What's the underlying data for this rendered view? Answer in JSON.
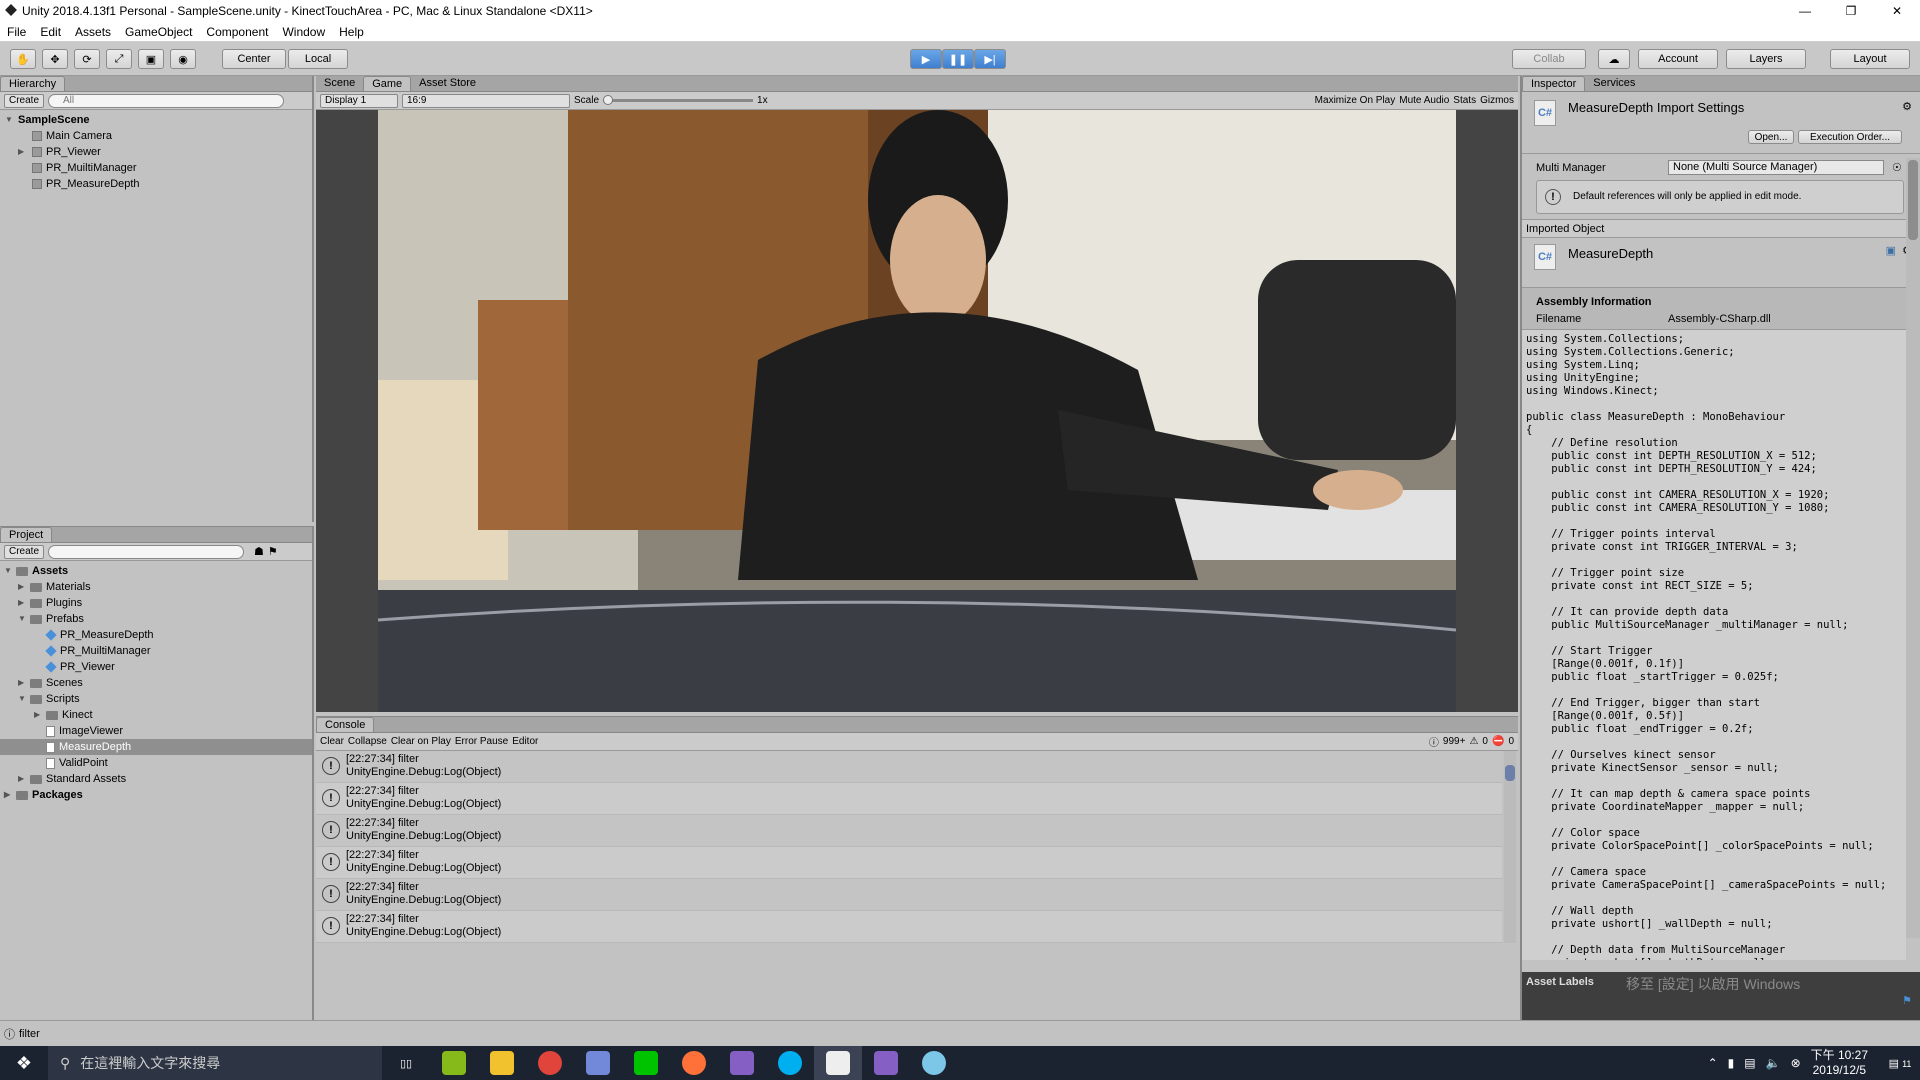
{
  "window": {
    "title": "Unity 2018.4.13f1 Personal - SampleScene.unity - KinectTouchArea - PC, Mac & Linux Standalone <DX11>"
  },
  "menu": [
    "File",
    "Edit",
    "Assets",
    "GameObject",
    "Component",
    "Window",
    "Help"
  ],
  "toolbar": {
    "center": "Center",
    "local": "Local",
    "collab": "Collab",
    "account": "Account",
    "layers": "Layers",
    "layout": "Layout"
  },
  "hierarchy": {
    "tab": "Hierarchy",
    "create": "Create",
    "search_placeholder": "All",
    "scene": "SampleScene",
    "items": [
      "Main Camera",
      "PR_Viewer",
      "PR_MuiltiManager",
      "PR_MeasureDepth"
    ]
  },
  "game": {
    "tabs": [
      "Scene",
      "Game",
      "Asset Store"
    ],
    "display": "Display 1",
    "aspect": "16:9",
    "scale_label": "Scale",
    "scale_value": "1x",
    "options": [
      "Maximize On Play",
      "Mute Audio",
      "Stats",
      "Gizmos"
    ]
  },
  "project": {
    "tab": "Project",
    "create": "Create",
    "assets": "Assets",
    "folders": [
      "Materials",
      "Plugins",
      "Prefabs"
    ],
    "prefabs": [
      "PR_MeasureDepth",
      "PR_MuiltiManager",
      "PR_Viewer"
    ],
    "folders2": [
      "Scenes",
      "Scripts"
    ],
    "scripts": [
      "Kinect",
      "ImageViewer",
      "MeasureDepth",
      "ValidPoint"
    ],
    "standard": "Standard Assets",
    "packages": "Packages"
  },
  "console": {
    "tab": "Console",
    "buttons": [
      "Clear",
      "Collapse",
      "Clear on Play",
      "Error Pause",
      "Editor"
    ],
    "count_logs": "999+",
    "count_warn": "0",
    "count_err": "0",
    "entries": [
      {
        "l1": "[22:27:34] filter",
        "l2": "UnityEngine.Debug:Log(Object)"
      },
      {
        "l1": "[22:27:34] filter",
        "l2": "UnityEngine.Debug:Log(Object)"
      },
      {
        "l1": "[22:27:34] filter",
        "l2": "UnityEngine.Debug:Log(Object)"
      },
      {
        "l1": "[22:27:34] filter",
        "l2": "UnityEngine.Debug:Log(Object)"
      },
      {
        "l1": "[22:27:34] filter",
        "l2": "UnityEngine.Debug:Log(Object)"
      },
      {
        "l1": "[22:27:34] filter",
        "l2": "UnityEngine.Debug:Log(Object)"
      }
    ]
  },
  "inspector": {
    "tabs": [
      "Inspector",
      "Services"
    ],
    "title": "MeasureDepth Import Settings",
    "open": "Open...",
    "exec_order": "Execution Order...",
    "multi_label": "Multi Manager",
    "multi_value": "None (Multi Source Manager)",
    "notice": "Default references will only be applied in edit mode.",
    "imported": "Imported Object",
    "script_name": "MeasureDepth",
    "assembly_title": "Assembly Information",
    "filename_label": "Filename",
    "filename_value": "Assembly-CSharp.dll",
    "code": "using System.Collections;\nusing System.Collections.Generic;\nusing System.Linq;\nusing UnityEngine;\nusing Windows.Kinect;\n\npublic class MeasureDepth : MonoBehaviour\n{\n    // Define resolution\n    public const int DEPTH_RESOLUTION_X = 512;\n    public const int DEPTH_RESOLUTION_Y = 424;\n\n    public const int CAMERA_RESOLUTION_X = 1920;\n    public const int CAMERA_RESOLUTION_Y = 1080;\n\n    // Trigger points interval\n    private const int TRIGGER_INTERVAL = 3;\n\n    // Trigger point size\n    private const int RECT_SIZE = 5;\n\n    // It can provide depth data\n    public MultiSourceManager _multiManager = null;\n\n    // Start Trigger\n    [Range(0.001f, 0.1f)]\n    public float _startTrigger = 0.025f;\n\n    // End Trigger, bigger than start\n    [Range(0.001f, 0.5f)]\n    public float _endTrigger = 0.2f;\n\n    // Ourselves kinect sensor\n    private KinectSensor _sensor = null;\n\n    // It can map depth & camera space points\n    private CoordinateMapper _mapper = null;\n\n    // Color space\n    private ColorSpacePoint[] _colorSpacePoints = null;\n\n    // Camera space\n    private CameraSpacePoint[] _cameraSpacePoints = null;\n\n    // Wall depth\n    private ushort[] _wallDepth = null;\n\n    // Depth data from MultiSourceManager\n    private ushort[] _depthData = null;",
    "asset_labels": "Asset Labels",
    "watermark": "移至 [設定] 以啟用 Windows"
  },
  "status": {
    "text": "filter"
  },
  "taskbar": {
    "search_placeholder": "在這裡輸入文字來搜尋",
    "time": "下午 10:27",
    "date": "2019/12/5",
    "notif": "11"
  }
}
